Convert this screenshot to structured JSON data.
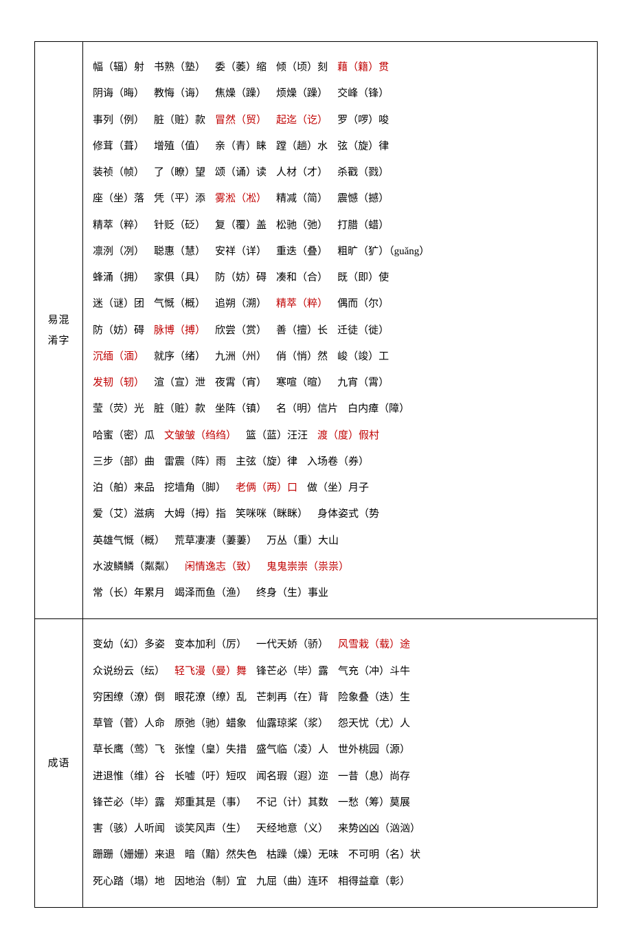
{
  "rows": [
    {
      "label": "易混\n淆字",
      "lines": [
        [
          {
            "t": "幅（辐）射",
            "c": "black"
          },
          {
            "t": "书熟（塾）",
            "c": "black"
          },
          {
            "t": "委（萎）缩",
            "c": "black"
          },
          {
            "t": "倾（顷）刻",
            "c": "black"
          },
          {
            "t": "藉（籍）贯",
            "c": "red"
          }
        ],
        [
          {
            "t": "阴诲（晦）",
            "c": "black"
          },
          {
            "t": "教悔（诲）",
            "c": "black"
          },
          {
            "t": "焦燥（躁）",
            "c": "black"
          },
          {
            "t": "烦燥（躁）",
            "c": "black"
          },
          {
            "t": "交峰（锋）",
            "c": "black"
          }
        ],
        [
          {
            "t": "事列（例）",
            "c": "black"
          },
          {
            "t": "脏（赃）款",
            "c": "black"
          },
          {
            "t": "冒然（贸）",
            "c": "red"
          },
          {
            "t": "起迄（讫）",
            "c": "red"
          },
          {
            "t": "罗（啰）唆",
            "c": "black"
          }
        ],
        [
          {
            "t": "修茸（葺）",
            "c": "black"
          },
          {
            "t": "增殖（值）",
            "c": "black"
          },
          {
            "t": "亲（青）睐",
            "c": "black"
          },
          {
            "t": "蹚（趟）水",
            "c": "black"
          },
          {
            "t": "弦（旋）律",
            "c": "black"
          }
        ],
        [
          {
            "t": "装祯（帧）",
            "c": "black"
          },
          {
            "t": "了（瞭）望",
            "c": "black"
          },
          {
            "t": "颂（诵）读",
            "c": "black"
          },
          {
            "t": "人材（才）",
            "c": "black"
          },
          {
            "t": "杀戳（戮）",
            "c": "black"
          }
        ],
        [
          {
            "t": "座（坐）落",
            "c": "black"
          },
          {
            "t": "凭（平）添",
            "c": "black"
          },
          {
            "t": "雾淞（凇）",
            "c": "red"
          },
          {
            "t": "精减（简）",
            "c": "black"
          },
          {
            "t": "震憾（撼）",
            "c": "black"
          }
        ],
        [
          {
            "t": "精萃（粹）",
            "c": "black"
          },
          {
            "t": "针贬（砭）",
            "c": "black"
          },
          {
            "t": "复（覆）盖",
            "c": "black"
          },
          {
            "t": "松驰（弛）",
            "c": "black"
          },
          {
            "t": "打腊（蜡）",
            "c": "black"
          }
        ],
        [
          {
            "t": "凛洌（冽）",
            "c": "black"
          },
          {
            "t": "聪惠（慧）",
            "c": "black"
          },
          {
            "t": "安祥（详）",
            "c": "black"
          },
          {
            "t": "重迭（叠）",
            "c": "black"
          },
          {
            "t": "粗旷（犷）（guǎng）",
            "c": "black"
          }
        ],
        [
          {
            "t": "蜂涌（拥）",
            "c": "black"
          },
          {
            "t": "家俱（具）",
            "c": "black"
          },
          {
            "t": "防（妨）碍",
            "c": "black"
          },
          {
            "t": "凑和（合）",
            "c": "black"
          },
          {
            "t": "既（即）使",
            "c": "black"
          }
        ],
        [
          {
            "t": "迷（谜）团",
            "c": "black"
          },
          {
            "t": "气慨（概）",
            "c": "black"
          },
          {
            "t": "追朔（溯）",
            "c": "black"
          },
          {
            "t": "精萃（粹）",
            "c": "red"
          },
          {
            "t": "偶而（尔）",
            "c": "black"
          }
        ],
        [
          {
            "t": "防（妨）碍",
            "c": "black"
          },
          {
            "t": "脉博（搏）",
            "c": "red"
          },
          {
            "t": "欣尝（赏）",
            "c": "black"
          },
          {
            "t": "善（擅）长",
            "c": "black"
          },
          {
            "t": "迁徒（徙）",
            "c": "black"
          }
        ],
        [
          {
            "t": "沉缅（湎）",
            "c": "red"
          },
          {
            "t": "就序（绪）",
            "c": "black"
          },
          {
            "t": "九洲（州）",
            "c": "black"
          },
          {
            "t": "俏（悄）然",
            "c": "black"
          },
          {
            "t": "峻（竣）工",
            "c": "black"
          }
        ],
        [
          {
            "t": "发韧（轫）",
            "c": "red"
          },
          {
            "t": "渲（宣）泄",
            "c": "black"
          },
          {
            "t": "夜霄（宵）",
            "c": "black"
          },
          {
            "t": "寒喧（暄）",
            "c": "black"
          },
          {
            "t": "九宵（霄）",
            "c": "black"
          }
        ],
        [
          {
            "t": "莹（荧）光",
            "c": "black"
          },
          {
            "t": "脏（赃）款",
            "c": "black"
          },
          {
            "t": "坐阵（镇）",
            "c": "black"
          },
          {
            "t": "名（明）信片",
            "c": "black"
          },
          {
            "t": "白内瘴（障）",
            "c": "black"
          }
        ],
        [
          {
            "t": "哈蜜（密）瓜",
            "c": "black"
          },
          {
            "t": "文皱皱（绉绉）",
            "c": "red"
          },
          {
            "t": "篮（蓝）汪汪",
            "c": "black"
          },
          {
            "t": "渡（度）假村",
            "c": "red"
          }
        ],
        [
          {
            "t": "三步（部）曲",
            "c": "black"
          },
          {
            "t": "雷震（阵）雨",
            "c": "black"
          },
          {
            "t": "主弦（旋）律",
            "c": "black"
          },
          {
            "t": "入场卷（券）",
            "c": "black"
          }
        ],
        [
          {
            "t": "泊（舶）来品",
            "c": "black"
          },
          {
            "t": "挖墙角（脚）",
            "c": "black"
          },
          {
            "t": "老俩（两）口",
            "c": "red"
          },
          {
            "t": "做（坐）月子",
            "c": "black"
          }
        ],
        [
          {
            "t": "爱（艾）滋病",
            "c": "black"
          },
          {
            "t": "大姆（拇）指",
            "c": "black"
          },
          {
            "t": "笑咪咪（眯眯）",
            "c": "black"
          },
          {
            "t": "身体姿式（势",
            "c": "black"
          }
        ],
        [
          {
            "t": "英雄气慨（概）",
            "c": "black"
          },
          {
            "t": "荒草凄凄（萋萋）",
            "c": "black"
          },
          {
            "t": "万丛（重）大山",
            "c": "black"
          }
        ],
        [
          {
            "t": "水波鳞鳞（粼粼）",
            "c": "black"
          },
          {
            "t": "闲情逸志（致）",
            "c": "red"
          },
          {
            "t": "鬼鬼崇崇（祟祟）",
            "c": "red"
          }
        ],
        [
          {
            "t": "常（长）年累月",
            "c": "black"
          },
          {
            "t": "竭泽而鱼（渔）",
            "c": "black"
          },
          {
            "t": "终身（生）事业",
            "c": "black"
          }
        ]
      ]
    },
    {
      "label": "成语",
      "lines": [
        [
          {
            "t": "变幼（幻）多姿",
            "c": "black"
          },
          {
            "t": "变本加利（厉）",
            "c": "black"
          },
          {
            "t": "一代天娇（骄）",
            "c": "black"
          },
          {
            "t": "风雪栽（载）途",
            "c": "red"
          }
        ],
        [
          {
            "t": "众说纷云（纭）",
            "c": "black"
          },
          {
            "t": "轻飞漫（曼）舞",
            "c": "red"
          },
          {
            "t": "锋芒必（毕）露",
            "c": "black"
          },
          {
            "t": "气充（冲）斗牛",
            "c": "black"
          }
        ],
        [
          {
            "t": "穷困缭（潦）倒",
            "c": "black"
          },
          {
            "t": "眼花潦（缭）乱",
            "c": "black"
          },
          {
            "t": "芒刺再（在）背",
            "c": "black"
          },
          {
            "t": "险象叠（迭）生",
            "c": "black"
          }
        ],
        [
          {
            "t": "草管（菅）人命",
            "c": "black"
          },
          {
            "t": "原弛（驰）蜡象",
            "c": "black"
          },
          {
            "t": "仙露琼桨（浆）",
            "c": "black"
          },
          {
            "t": "怨天忧（尤）人",
            "c": "black"
          }
        ],
        [
          {
            "t": "草长鹰（莺）飞",
            "c": "black"
          },
          {
            "t": "张惶（皇）失措",
            "c": "black"
          },
          {
            "t": "盛气临（凌）人",
            "c": "black"
          },
          {
            "t": "世外桃园（源）",
            "c": "black"
          }
        ],
        [
          {
            "t": "进退惟（维）谷",
            "c": "black"
          },
          {
            "t": "长嘘（吁）短叹",
            "c": "black"
          },
          {
            "t": "闻名瑕（遐）迩",
            "c": "black"
          },
          {
            "t": "一昔（息）尚存",
            "c": "black"
          }
        ],
        [
          {
            "t": "锋芒必（毕）露",
            "c": "black"
          },
          {
            "t": "郑重其是（事）",
            "c": "black"
          },
          {
            "t": "不记（计）其数",
            "c": "black"
          },
          {
            "t": "一愁（筹）莫展",
            "c": "black"
          }
        ],
        [
          {
            "t": "害（骇）人听闻",
            "c": "black"
          },
          {
            "t": "谈笑风声（生）",
            "c": "black"
          },
          {
            "t": "天经地意（义）",
            "c": "black"
          },
          {
            "t": "来势凶凶（汹汹）",
            "c": "black"
          }
        ],
        [
          {
            "t": "跚跚（姗姗）来退",
            "c": "black"
          },
          {
            "t": "暗（黯）然失色",
            "c": "black"
          },
          {
            "t": "枯躁（燥）无味",
            "c": "black"
          },
          {
            "t": "不可明（名）状",
            "c": "black"
          }
        ],
        [
          {
            "t": "死心踏（塌）地",
            "c": "black"
          },
          {
            "t": "因地治（制）宜",
            "c": "black"
          },
          {
            "t": "九屈（曲）连环",
            "c": "black"
          },
          {
            "t": "相得益章（彰）",
            "c": "black"
          }
        ]
      ]
    }
  ]
}
